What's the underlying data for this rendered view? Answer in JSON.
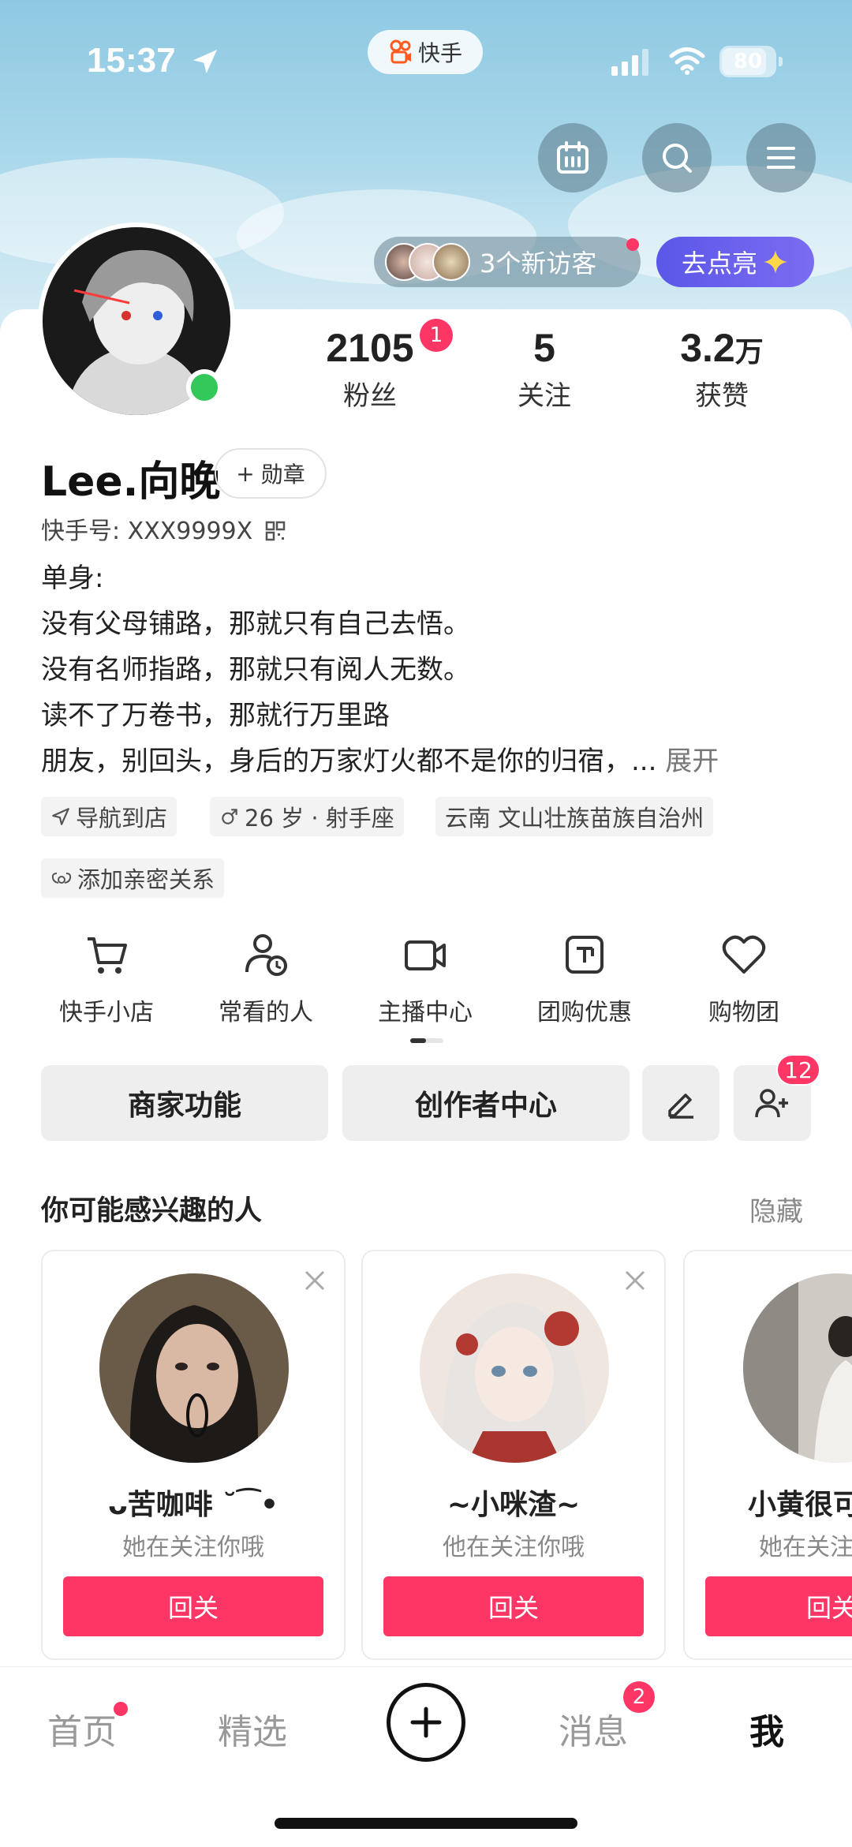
{
  "status_bar": {
    "time": "15:37",
    "app_name": "快手",
    "battery": "80"
  },
  "visitors": {
    "label": "3个新访客"
  },
  "light_up": {
    "label": "去点亮"
  },
  "stats": [
    {
      "value": "2105",
      "unit": "",
      "label": "粉丝",
      "badge": "1"
    },
    {
      "value": "5",
      "unit": "",
      "label": "关注"
    },
    {
      "value": "3.2",
      "unit": "万",
      "label": "获赞"
    }
  ],
  "profile": {
    "name": "Lee.向晚",
    "medal_label": "勋章",
    "kuaishou_id": "快手号: XXX9999X",
    "bio_lines": [
      "单身:",
      "没有父母铺路，那就只有自己去悟。",
      "没有名师指路，那就只有阅人无数。",
      "读不了万卷书，那就行万里路",
      "朋友，别回头，身后的万家灯火都不是你的归宿，..."
    ],
    "bio_more": "展开"
  },
  "tags": {
    "nav": "导航到店",
    "age": "26 岁 · 射手座",
    "location": "云南 文山壮族苗族自治州",
    "relation": "添加亲密关系"
  },
  "quick_actions": [
    {
      "label": "快手小店",
      "icon": "cart-icon"
    },
    {
      "label": "常看的人",
      "icon": "user-clock-icon"
    },
    {
      "label": "主播中心",
      "icon": "camera-icon"
    },
    {
      "label": "团购优惠",
      "icon": "coupon-icon"
    },
    {
      "label": "购物团",
      "icon": "heart-icon"
    }
  ],
  "action_buttons": {
    "merchant": "商家功能",
    "creator": "创作者中心",
    "add_friend_badge": "12"
  },
  "recommend": {
    "title": "你可能感兴趣的人",
    "hide": "隐藏",
    "cards": [
      {
        "name": "ᴗ苦咖啡 ˘⁀•",
        "sub": "她在关注你哦",
        "button": "回关"
      },
      {
        "name": "~小咪渣~",
        "sub": "他在关注你哦",
        "button": "回关"
      },
      {
        "name": "小黄很可",
        "sub": "她在关注",
        "button": "回关"
      }
    ]
  },
  "bottom_nav": {
    "home": "首页",
    "featured": "精选",
    "messages": "消息",
    "messages_badge": "2",
    "me": "我"
  },
  "colors": {
    "accent": "#fe3666",
    "online": "#34c759",
    "light_up": "#5b57e8"
  }
}
